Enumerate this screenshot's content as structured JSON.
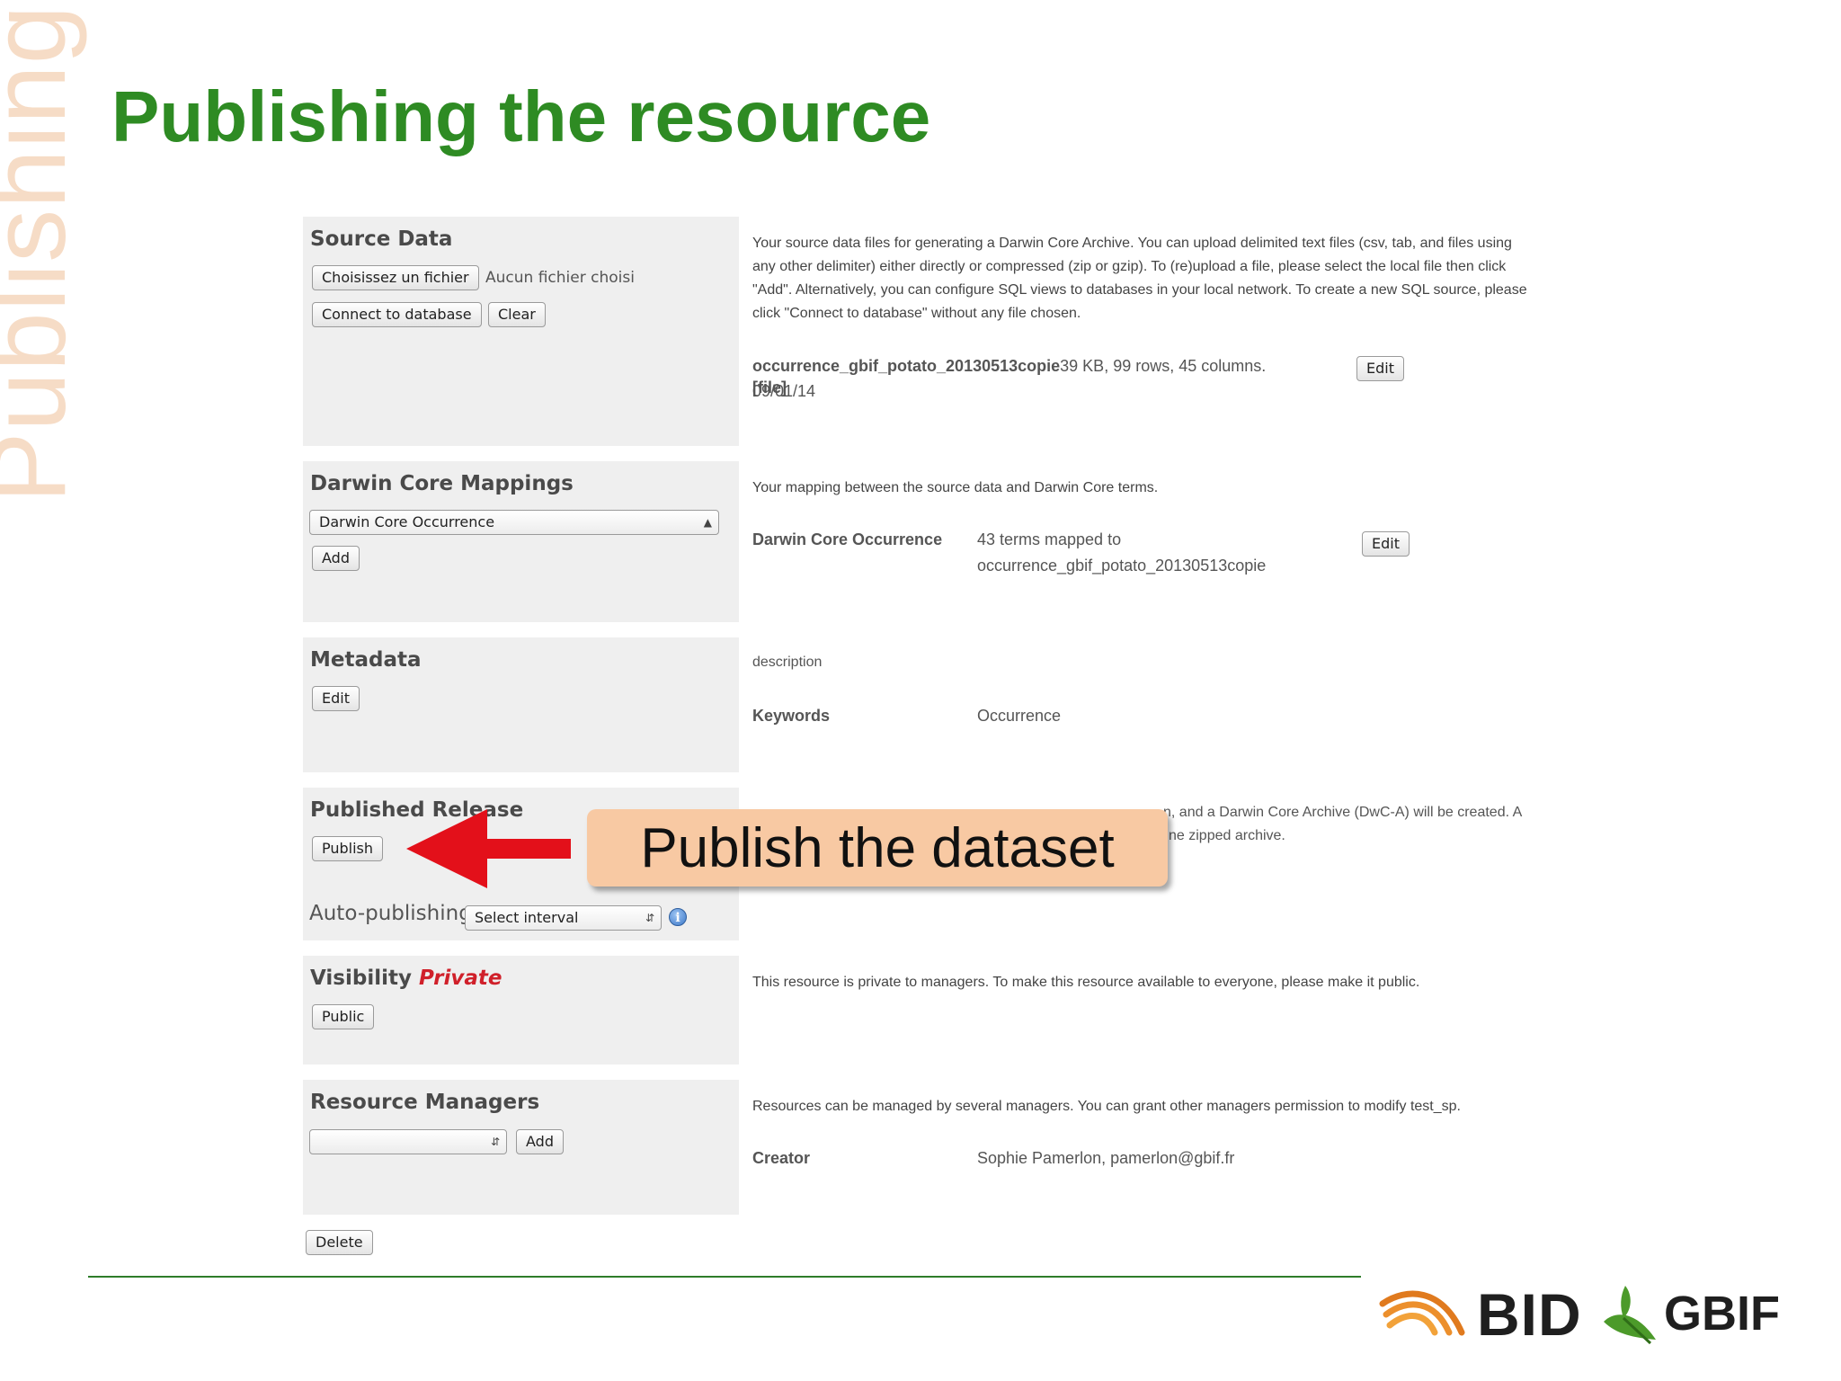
{
  "side_label": "Publishing",
  "slide_title": "Publishing the resource",
  "source_data": {
    "title": "Source Data",
    "choose_file_label": "Choisissez un fichier",
    "no_file_text": "Aucun fichier choisi",
    "connect_label": "Connect to database",
    "clear_label": "Clear",
    "description": "Your source data files for generating a Darwin Core Archive. You can upload delimited text files (csv, tab, and files using any other delimiter) either directly or compressed (zip or gzip). To (re)upload a file, please select the local file then click \"Add\".  Alternatively, you can configure SQL views to databases in your local network. To create a new SQL source, please click \"Connect to database\" without any file chosen.",
    "file_name": "occurrence_gbif_potato_20130513copie",
    "file_info": "39 KB, 99 rows, 45 columns. 09/01/14",
    "file_tag": "[file]",
    "edit_label": "Edit"
  },
  "mappings": {
    "title": "Darwin Core Mappings",
    "select_value": "Darwin Core Occurrence",
    "add_label": "Add",
    "description": "Your mapping between the source data and Darwin Core terms.",
    "row_label": "Darwin Core Occurrence",
    "row_value_line1": "43 terms mapped to",
    "row_value_line2": "occurrence_gbif_potato_20130513copie",
    "edit_label": "Edit"
  },
  "metadata": {
    "title": "Metadata",
    "edit_label": "Edit",
    "description": "description",
    "keywords_label": "Keywords",
    "keywords_value": "Occurrence"
  },
  "published_release": {
    "title": "Published Release",
    "publish_label": "Publish",
    "auto_label": "Auto-publishing",
    "interval_value": "Select interval",
    "description_line1": "n, and a Darwin Core Archive (DwC-A) will be created. A",
    "description_line2": "ne zipped archive."
  },
  "visibility": {
    "title": "Visibility",
    "status": "Private",
    "public_label": "Public",
    "description": "This resource is private to managers. To make this resource available to everyone, please make it public."
  },
  "managers": {
    "title": "Resource Managers",
    "add_label": "Add",
    "description": "Resources can be managed by several managers. You can grant other managers permission to modify test_sp.",
    "creator_label": "Creator",
    "creator_value": "Sophie Pamerlon, pamerlon@gbif.fr"
  },
  "delete_label": "Delete",
  "callout": "Publish the dataset",
  "logos": {
    "bid": "BID",
    "gbif": "GBIF"
  },
  "colors": {
    "title_green": "#2e8b23",
    "status_red": "#d0202a",
    "arrow_red": "#e3101a",
    "callout_bg": "#f8c9a3"
  }
}
